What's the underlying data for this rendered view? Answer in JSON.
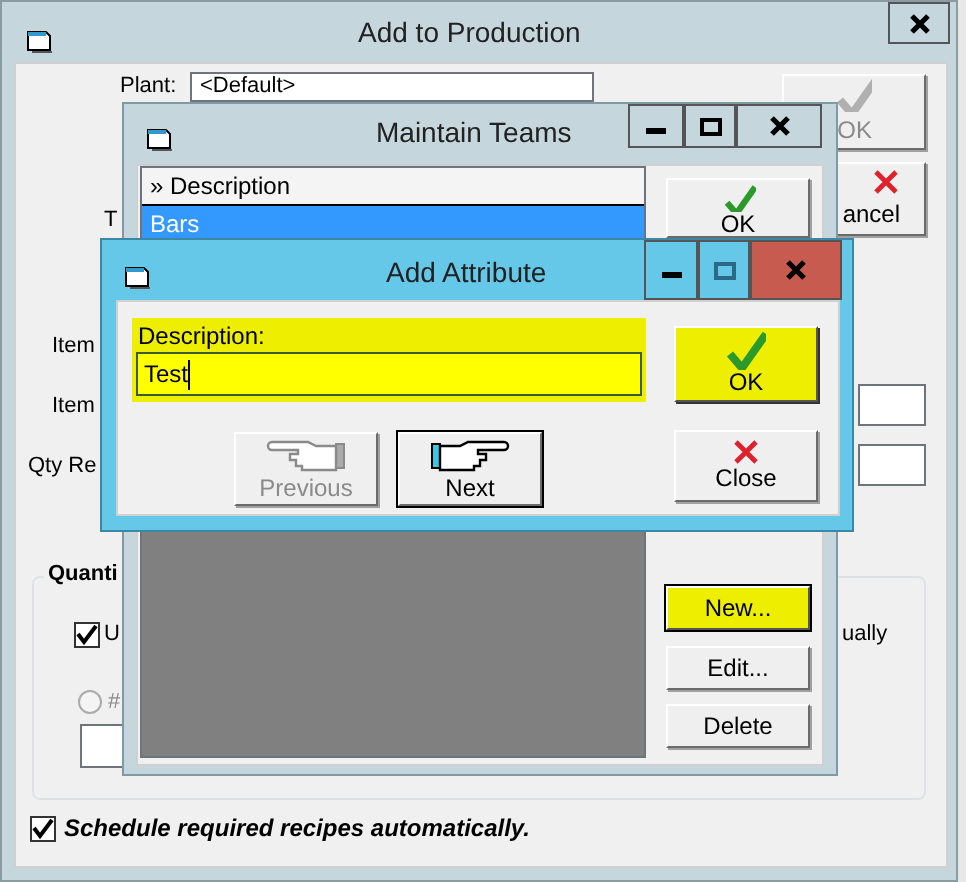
{
  "production": {
    "title": "Add to Production",
    "plant_label": "Plant:",
    "plant_value": "<Default>",
    "ok_button": {
      "label": "OK",
      "disabled": true
    },
    "cancel_button": {
      "label": "ancel"
    },
    "labels": [
      "T",
      "Item",
      "Item",
      "Qty Re"
    ],
    "quantity_group": {
      "title": "Quanti",
      "use_checkbox": {
        "label": "U",
        "checked": true
      },
      "side_text": "ually",
      "radio": {
        "label": "#",
        "selected": false,
        "disabled": true
      }
    },
    "schedule_checkbox": {
      "label": "Schedule required recipes automatically.",
      "checked": true
    }
  },
  "teams": {
    "title": "Maintain Teams",
    "column": "» Description",
    "rows": [
      {
        "text": "Bars",
        "selected": true
      }
    ],
    "ok_button": {
      "label": "OK"
    },
    "buttons": [
      {
        "label": "New...",
        "highlighted": true
      },
      {
        "label": "Edit...",
        "highlighted": false
      },
      {
        "label": "Delete",
        "highlighted": false
      }
    ]
  },
  "attribute": {
    "title": "Add Attribute",
    "field": {
      "label": "Description:",
      "value": "Test"
    },
    "buttons": [
      {
        "kind": "ok",
        "label": "OK",
        "highlighted": true,
        "disabled": false,
        "focused": false
      },
      {
        "kind": "previous",
        "label": "Previous",
        "highlighted": false,
        "disabled": true,
        "focused": false
      },
      {
        "kind": "next",
        "label": "Next",
        "highlighted": false,
        "disabled": false,
        "focused": true
      },
      {
        "kind": "close",
        "label": "Close",
        "highlighted": false,
        "disabled": false,
        "focused": false
      }
    ]
  }
}
